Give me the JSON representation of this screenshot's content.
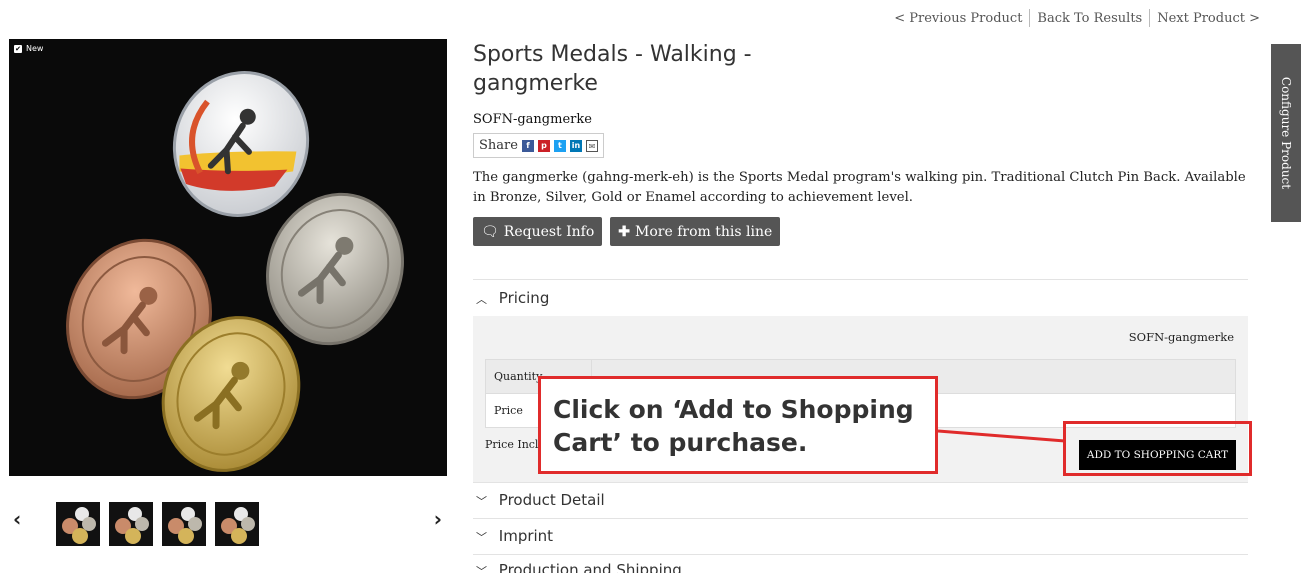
{
  "nav": {
    "prev": "< Previous Product",
    "back": "Back To Results",
    "next": "Next Product >"
  },
  "image": {
    "badge": "New",
    "check_icon": "✔",
    "prev_arrow": "‹",
    "next_arrow": "›",
    "thumbnail_count": 4
  },
  "product": {
    "title": "Sports Medals - Walking - gangmerke",
    "sku": "SOFN-gangmerke",
    "share_label": "Share",
    "share_icons": [
      "facebook-icon",
      "pinterest-icon",
      "twitter-icon",
      "linkedin-icon",
      "email-icon"
    ],
    "description": "The gangmerke (gahng-merk-eh) is the Sports Medal program's walking pin. Traditional Clutch Pin Back. Available in Bronze, Silver, Gold or Enamel according to achievement level.",
    "request_info": "Request Info",
    "more_from_line": "More from this line"
  },
  "sections": {
    "pricing": "Pricing",
    "product_detail": "Product Detail",
    "imprint": "Imprint",
    "production_shipping": "Production and Shipping"
  },
  "pricing": {
    "sku": "SOFN-gangmerke",
    "quantity_label": "Quantity",
    "price_label": "Price",
    "inclusive_label": "Price Incl",
    "add_to_cart": "ADD TO SHOPPING CART"
  },
  "callout": {
    "text": "Click on ‘Add to Shopping Cart’ to purchase."
  },
  "config_tab": "Configure Product",
  "colors": {
    "accent_red": "#e02b2b",
    "button_gray": "#555555"
  }
}
